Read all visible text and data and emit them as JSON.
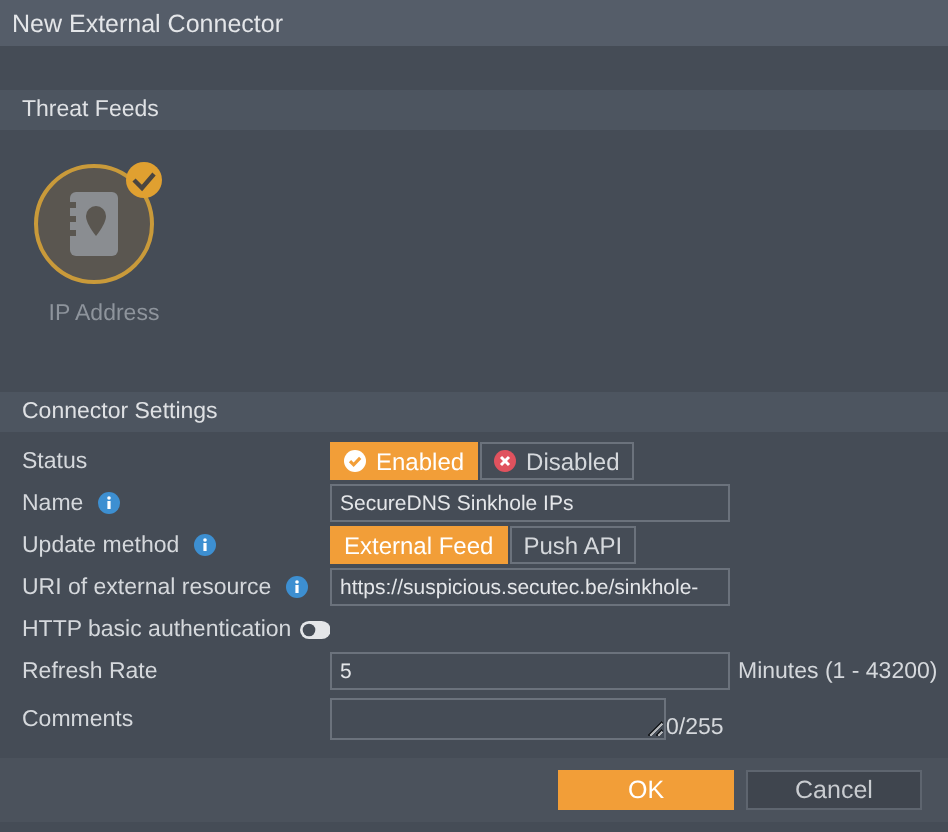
{
  "window": {
    "title": "New External Connector"
  },
  "threat_feeds": {
    "title": "Threat Feeds",
    "items": [
      {
        "label": "IP Address",
        "selected": true
      }
    ]
  },
  "connector_settings": {
    "title": "Connector Settings",
    "rows": [
      {
        "kind": "status",
        "label": "Status",
        "info": false,
        "options": [
          {
            "label": "Enabled",
            "selected": true
          },
          {
            "label": "Disabled",
            "selected": false
          }
        ]
      },
      {
        "kind": "text",
        "label": "Name",
        "info": true,
        "value": "SecureDNS Sinkhole IPs"
      },
      {
        "kind": "segmented",
        "label": "Update method",
        "info": true,
        "options": [
          {
            "label": "External Feed",
            "selected": true
          },
          {
            "label": "Push API",
            "selected": false
          }
        ]
      },
      {
        "kind": "text",
        "label": "URI of external resource",
        "info": true,
        "value": "https://suspicious.secutec.be/sinkhole-"
      },
      {
        "kind": "switch",
        "label": "HTTP basic authentication",
        "info": false,
        "on": false
      },
      {
        "kind": "text",
        "label": "Refresh Rate",
        "info": false,
        "value": "5",
        "suffix": "Minutes (1 - 43200)"
      },
      {
        "kind": "textarea",
        "label": "Comments",
        "info": false,
        "counter": "0/255"
      }
    ]
  },
  "buttons": [
    {
      "label": "OK",
      "primary": true
    },
    {
      "label": "Cancel",
      "primary": false
    }
  ]
}
